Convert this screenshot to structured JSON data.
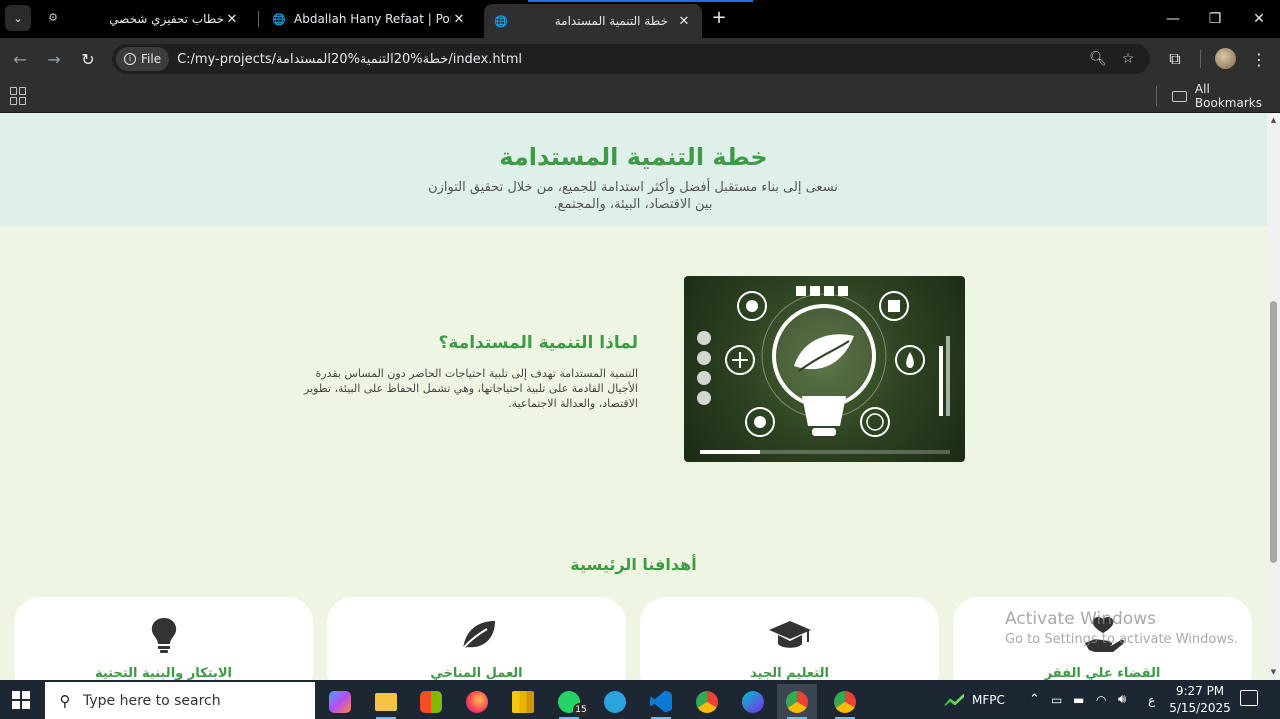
{
  "browser": {
    "tabs": [
      {
        "title": "خطاب تحفيزي شخصي",
        "active": false
      },
      {
        "title": "Abdallah Hany Refaat | Portfolio",
        "active": false
      },
      {
        "title": "خطة التنمية المستدامة",
        "active": true
      }
    ],
    "address": {
      "security_chip": "File",
      "url": "C:/my-projects/خطة%20التنمية%20المستدامة/index.html"
    },
    "bookmarks_label": "All Bookmarks"
  },
  "page": {
    "hero": {
      "title": "خطة التنمية المستدامة",
      "subtitle": "نسعى إلى بناء مستقبل أفضل وأكثر استدامة للجميع، من خلال تحقيق التوازن بين الاقتصاد، البيئة، والمجتمع."
    },
    "why": {
      "title": "لماذا التنمية المستدامة؟",
      "text": "التنمية المستدامة تهدف إلى تلبية احتياجات الحاضر دون المساس بقدرة الأجيال القادمة على تلبية احتياجاتها، وهي تشمل الحفاظ على البيئة، تطوير الاقتصاد، والعدالة الاجتماعية."
    },
    "goals": {
      "title": "أهدافنا الرئيسية",
      "cards": [
        {
          "label": "القضاء علي الفقر",
          "icon": "hand-heart-icon"
        },
        {
          "label": "التعليم الجيد",
          "icon": "graduation-cap-icon"
        },
        {
          "label": "العمل المناخي",
          "icon": "leaf-icon"
        },
        {
          "label": "الابتكار والبنية التحتية",
          "icon": "lightbulb-icon"
        }
      ]
    }
  },
  "watermark": {
    "line1": "Activate Windows",
    "line2": "Go to Settings to activate Windows."
  },
  "taskbar": {
    "search_placeholder": "Type here to search",
    "whatsapp_badge": "15",
    "weather_label": "MFPC",
    "language": "ع",
    "time": "9:27 PM",
    "date": "5/15/2025"
  },
  "colors": {
    "accent_green": "#3d9b46",
    "hero_bg": "#dff0ea",
    "page_bg": "#eef6e3"
  }
}
